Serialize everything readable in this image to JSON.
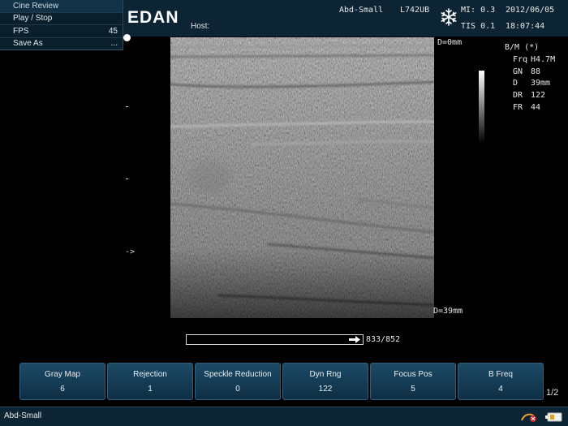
{
  "cine_menu": {
    "title": "Cine Review",
    "items": [
      {
        "label": "Play / Stop",
        "value": ""
      },
      {
        "label": "FPS",
        "value": "45"
      },
      {
        "label": "Save As",
        "value": "..."
      }
    ]
  },
  "header": {
    "logo": "EDAN",
    "host_label": "Host:",
    "preset": "Abd-Small",
    "probe": "L742UB",
    "mi": "MI: 0.3",
    "tis": "TIS 0.1",
    "date": "2012/06/05",
    "time": "18:07:44",
    "freeze_icon": "snowflake-icon"
  },
  "image": {
    "depth_top": "D=0mm",
    "depth_bottom": "D=39mm",
    "focus_marker": "->"
  },
  "params": {
    "mode": "B/M (*)",
    "rows": [
      {
        "key": "Frq",
        "value": "H4.7M"
      },
      {
        "key": "GN",
        "value": "88"
      },
      {
        "key": "D",
        "value": "39mm"
      },
      {
        "key": "DR",
        "value": "122"
      },
      {
        "key": "FR",
        "value": "44"
      }
    ]
  },
  "cine": {
    "count": "833/852",
    "arrow_icon": "arrow-right-icon"
  },
  "softkeys": [
    {
      "label": "Gray Map",
      "value": "6"
    },
    {
      "label": "Rejection",
      "value": "1"
    },
    {
      "label": "Speckle Reduction",
      "value": "0"
    },
    {
      "label": "Dyn Rng",
      "value": "122"
    },
    {
      "label": "Focus Pos",
      "value": "5"
    },
    {
      "label": "B Freq",
      "value": "4"
    }
  ],
  "page_indicator": "1/2",
  "status": {
    "preset": "Abd-Small"
  },
  "colors": {
    "panel": "#0c2433",
    "softkey": "#1d4a66"
  }
}
